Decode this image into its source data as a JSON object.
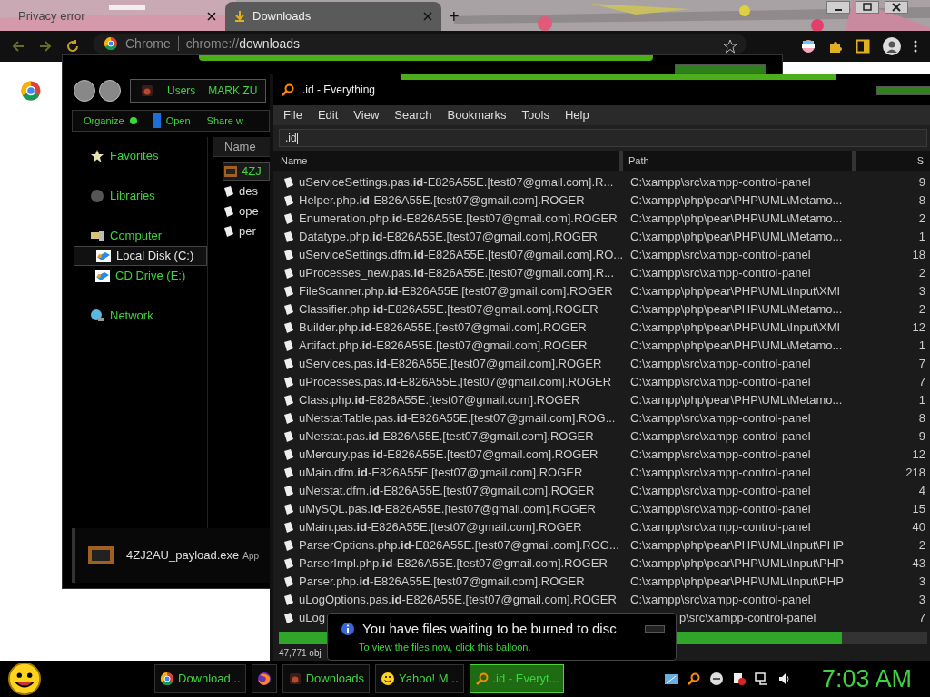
{
  "browser": {
    "tabs": [
      {
        "title": "Privacy error",
        "selected": false
      },
      {
        "title": "Downloads",
        "selected": true
      }
    ],
    "new_tab": "+",
    "omnibox": {
      "site": "Chrome",
      "url_prefix": "chrome://",
      "url_host": "downloads"
    }
  },
  "explorer": {
    "breadcrumb": [
      "Users",
      "MARK ZU"
    ],
    "toolbar": [
      {
        "label": "Organize",
        "kind": "dot"
      },
      {
        "label": "Open",
        "kind": "book"
      },
      {
        "label": "Share w",
        "kind": "none"
      }
    ],
    "nav": [
      {
        "label": "Favorites",
        "kind": "star",
        "selected": false
      },
      {
        "label": "Libraries",
        "kind": "library",
        "selected": false
      },
      {
        "label": "Computer",
        "kind": "computer",
        "selected": false,
        "children": [
          {
            "label": "Local Disk (C:)",
            "kind": "drive",
            "selected": true
          },
          {
            "label": "CD Drive (E:)",
            "kind": "drive",
            "selected": false
          }
        ]
      },
      {
        "label": "Network",
        "kind": "network",
        "selected": false
      }
    ],
    "column": "Name",
    "files": [
      {
        "name": "4ZJ",
        "kind": "app",
        "selected": true
      },
      {
        "name": "des",
        "kind": "doc",
        "selected": false
      },
      {
        "name": "ope",
        "kind": "doc",
        "selected": false
      },
      {
        "name": "per",
        "kind": "doc",
        "selected": false
      }
    ],
    "details": {
      "name": "4ZJ2AU_payload.exe",
      "type": "App"
    }
  },
  "everything": {
    "title": ".id - Everything",
    "menu": [
      "File",
      "Edit",
      "View",
      "Search",
      "Bookmarks",
      "Tools",
      "Help"
    ],
    "search": ".id",
    "columns": [
      "Name",
      "Path",
      "S"
    ],
    "rows": [
      {
        "name": "uServiceSettings.pas.**id**-E826A55E.[test07@gmail.com].R...",
        "path": "C:\\xampp\\src\\xampp-control-panel",
        "size": "9"
      },
      {
        "name": "Helper.php.**id**-E826A55E.[test07@gmail.com].ROGER",
        "path": "C:\\xampp\\php\\pear\\PHP\\UML\\Metamo...",
        "size": "8"
      },
      {
        "name": "Enumeration.php.**id**-E826A55E.[test07@gmail.com].ROGER",
        "path": "C:\\xampp\\php\\pear\\PHP\\UML\\Metamo...",
        "size": "2"
      },
      {
        "name": "Datatype.php.**id**-E826A55E.[test07@gmail.com].ROGER",
        "path": "C:\\xampp\\php\\pear\\PHP\\UML\\Metamo...",
        "size": "1"
      },
      {
        "name": "uServiceSettings.dfm.**id**-E826A55E.[test07@gmail.com].RO...",
        "path": "C:\\xampp\\src\\xampp-control-panel",
        "size": "18"
      },
      {
        "name": "uProcesses_new.pas.**id**-E826A55E.[test07@gmail.com].R...",
        "path": "C:\\xampp\\src\\xampp-control-panel",
        "size": "2"
      },
      {
        "name": "FileScanner.php.**id**-E826A55E.[test07@gmail.com].ROGER",
        "path": "C:\\xampp\\php\\pear\\PHP\\UML\\Input\\XMI",
        "size": "3"
      },
      {
        "name": "Classifier.php.**id**-E826A55E.[test07@gmail.com].ROGER",
        "path": "C:\\xampp\\php\\pear\\PHP\\UML\\Metamo...",
        "size": "2"
      },
      {
        "name": "Builder.php.**id**-E826A55E.[test07@gmail.com].ROGER",
        "path": "C:\\xampp\\php\\pear\\PHP\\UML\\Input\\XMI",
        "size": "12"
      },
      {
        "name": "Artifact.php.**id**-E826A55E.[test07@gmail.com].ROGER",
        "path": "C:\\xampp\\php\\pear\\PHP\\UML\\Metamo...",
        "size": "1"
      },
      {
        "name": "uServices.pas.**id**-E826A55E.[test07@gmail.com].ROGER",
        "path": "C:\\xampp\\src\\xampp-control-panel",
        "size": "7"
      },
      {
        "name": "uProcesses.pas.**id**-E826A55E.[test07@gmail.com].ROGER",
        "path": "C:\\xampp\\src\\xampp-control-panel",
        "size": "7"
      },
      {
        "name": "Class.php.**id**-E826A55E.[test07@gmail.com].ROGER",
        "path": "C:\\xampp\\php\\pear\\PHP\\UML\\Metamo...",
        "size": "1"
      },
      {
        "name": "uNetstatTable.pas.**id**-E826A55E.[test07@gmail.com].ROG...",
        "path": "C:\\xampp\\src\\xampp-control-panel",
        "size": "8"
      },
      {
        "name": "uNetstat.pas.**id**-E826A55E.[test07@gmail.com].ROGER",
        "path": "C:\\xampp\\src\\xampp-control-panel",
        "size": "9"
      },
      {
        "name": "uMercury.pas.**id**-E826A55E.[test07@gmail.com].ROGER",
        "path": "C:\\xampp\\src\\xampp-control-panel",
        "size": "12"
      },
      {
        "name": "uMain.dfm.**id**-E826A55E.[test07@gmail.com].ROGER",
        "path": "C:\\xampp\\src\\xampp-control-panel",
        "size": "218"
      },
      {
        "name": "uNetstat.dfm.**id**-E826A55E.[test07@gmail.com].ROGER",
        "path": "C:\\xampp\\src\\xampp-control-panel",
        "size": "4"
      },
      {
        "name": "uMySQL.pas.**id**-E826A55E.[test07@gmail.com].ROGER",
        "path": "C:\\xampp\\src\\xampp-control-panel",
        "size": "15"
      },
      {
        "name": "uMain.pas.**id**-E826A55E.[test07@gmail.com].ROGER",
        "path": "C:\\xampp\\src\\xampp-control-panel",
        "size": "40"
      },
      {
        "name": "ParserOptions.php.**id**-E826A55E.[test07@gmail.com].ROG...",
        "path": "C:\\xampp\\php\\pear\\PHP\\UML\\Input\\PHP",
        "size": "2"
      },
      {
        "name": "ParserImpl.php.**id**-E826A55E.[test07@gmail.com].ROGER",
        "path": "C:\\xampp\\php\\pear\\PHP\\UML\\Input\\PHP",
        "size": "43"
      },
      {
        "name": "Parser.php.**id**-E826A55E.[test07@gmail.com].ROGER",
        "path": "C:\\xampp\\php\\pear\\PHP\\UML\\Input\\PHP",
        "size": "3"
      },
      {
        "name": "uLogOptions.pas.**id**-E826A55E.[test07@gmail.com].ROGER",
        "path": "C:\\xampp\\src\\xampp-control-panel",
        "size": "3"
      },
      {
        "name": "uLog",
        "path": "p\\src\\xampp-control-panel",
        "size": "7",
        "kind": "covered"
      }
    ],
    "status": "47,771 obj"
  },
  "balloon": {
    "title": "You have files waiting to be burned to disc",
    "text": "To view the files now, click this balloon."
  },
  "taskbar": {
    "buttons": [
      {
        "label": "Download...",
        "kind": "chrome",
        "selected": false
      },
      {
        "kind": "firefox",
        "selected": false
      },
      {
        "label": "Downloads",
        "kind": "explorer",
        "selected": false
      },
      {
        "label": "Yahoo! M...",
        "kind": "smiley",
        "selected": false
      },
      {
        "label": ".id - Everyt...",
        "kind": "search",
        "selected": true
      }
    ],
    "clock": "7:03 AM"
  }
}
